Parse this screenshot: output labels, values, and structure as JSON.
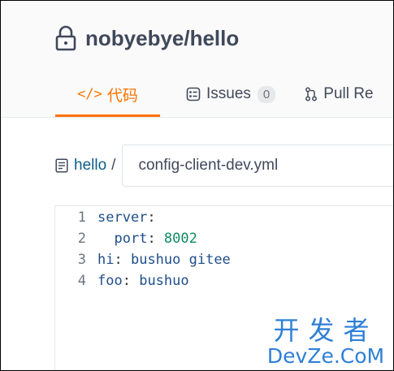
{
  "repo": {
    "title": "nobyebye/hello",
    "icon": "lock-icon"
  },
  "tabs": {
    "code": {
      "icon_text": "</>",
      "label": "代码"
    },
    "issues": {
      "label": "Issues",
      "count": "0"
    },
    "pull_requests": {
      "label": "Pull Re"
    }
  },
  "breadcrumb": {
    "root": "hello",
    "separator": "/",
    "filename": "config-client-dev.yml"
  },
  "code": {
    "lines": [
      {
        "num": "1",
        "indent": "",
        "key": "server",
        "colon": ":",
        "value": "",
        "value_type": "none"
      },
      {
        "num": "2",
        "indent": "  ",
        "key": "port",
        "colon": ":",
        "value": " 8002",
        "value_type": "num"
      },
      {
        "num": "3",
        "indent": "",
        "key": "hi",
        "colon": ":",
        "value": " bushuo gitee",
        "value_type": "str"
      },
      {
        "num": "4",
        "indent": "",
        "key": "foo",
        "colon": ":",
        "value": " bushuo",
        "value_type": "str"
      }
    ]
  },
  "watermark": {
    "cn": "开发者",
    "en": "DevZe.CoM"
  },
  "colors": {
    "accent": "#fe7300",
    "link": "#0c5e8c",
    "watermark": "#2f7fd6"
  }
}
